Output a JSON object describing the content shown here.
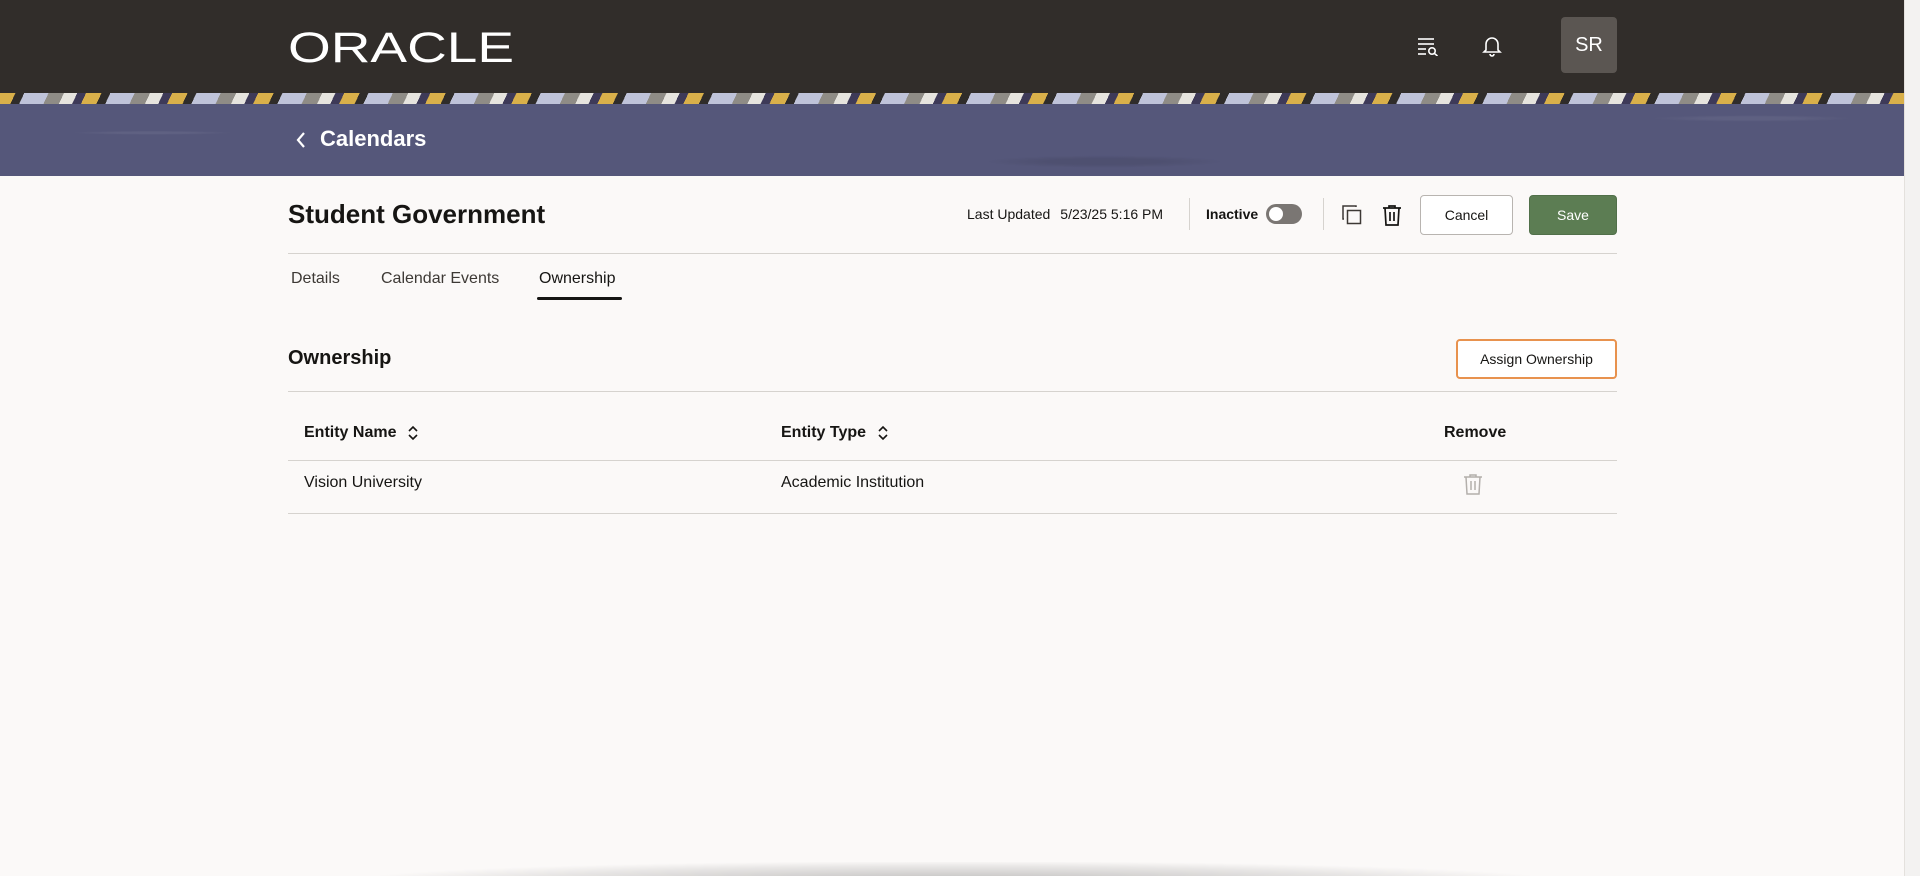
{
  "header": {
    "logo_text": "ORACLE",
    "icons": [
      "search-list-icon",
      "bell-icon"
    ],
    "avatar_initials": "SR"
  },
  "banner": {
    "back_icon": "chevron-left-icon",
    "title": "Calendars"
  },
  "record": {
    "title": "Student Government",
    "last_updated_label": "Last Updated",
    "last_updated_value": "5/23/25 5:16 PM",
    "inactive_label": "Inactive",
    "inactive_on": false,
    "cancel_label": "Cancel",
    "save_label": "Save"
  },
  "tabs": [
    {
      "label": "Details",
      "active": false
    },
    {
      "label": "Calendar Events",
      "active": false
    },
    {
      "label": "Ownership",
      "active": true
    }
  ],
  "ownership": {
    "title": "Ownership",
    "assign_label": "Assign Ownership",
    "columns": [
      "Entity Name",
      "Entity Type",
      "Remove"
    ],
    "rows": [
      {
        "entity_name": "Vision University",
        "entity_type": "Academic Institution"
      }
    ]
  },
  "colors": {
    "topbar": "#312d2a",
    "banner": "#55577a",
    "save_button": "#5c7d53",
    "assign_border": "#e8924e"
  }
}
